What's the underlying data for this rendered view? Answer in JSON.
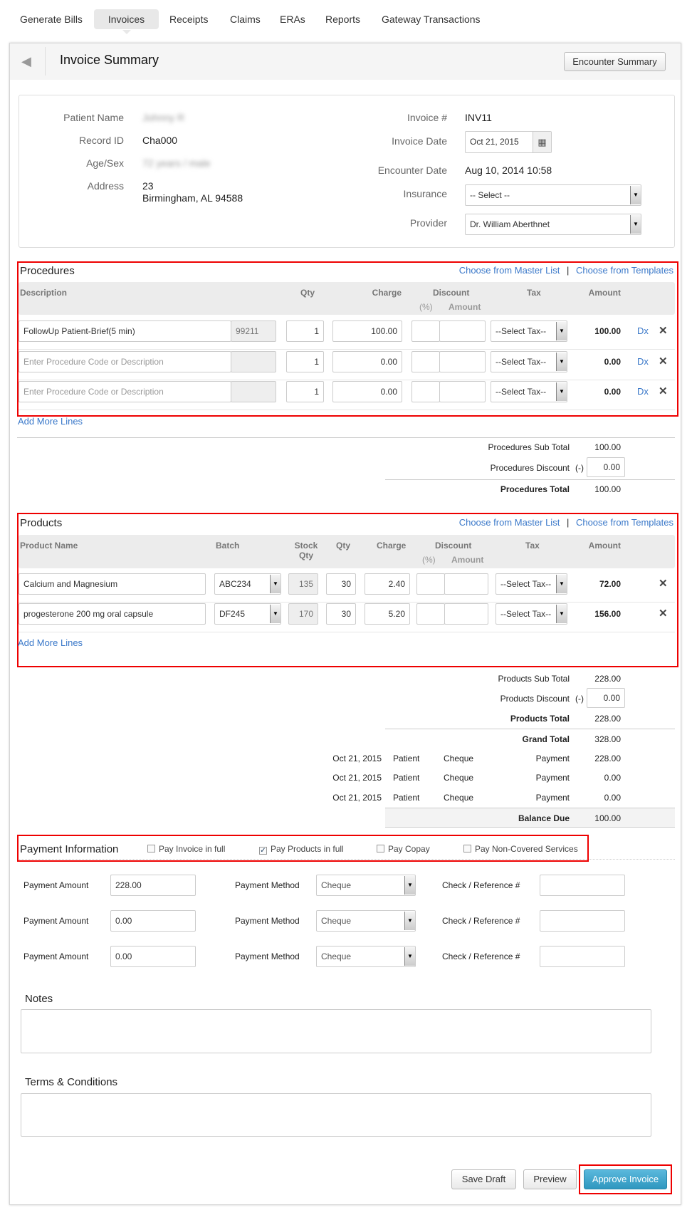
{
  "tabs": [
    "Generate Bills",
    "Invoices",
    "Receipts",
    "Claims",
    "ERAs",
    "Reports",
    "Gateway Transactions"
  ],
  "active_tab": "Invoices",
  "header": {
    "title": "Invoice Summary",
    "encounter_button": "Encounter Summary"
  },
  "patient": {
    "name_label": "Patient Name",
    "name": "Johnny R",
    "record_label": "Record ID",
    "record": "Cha000",
    "age_label": "Age/Sex",
    "age": "72 years / male",
    "address_label": "Address",
    "address1": "23",
    "address2": "Birmingham, AL 94588"
  },
  "invoice": {
    "num_label": "Invoice #",
    "num": "INV11",
    "date_label": "Invoice Date",
    "date": "Oct 21, 2015",
    "enc_label": "Encounter Date",
    "enc": "Aug 10, 2014 10:58",
    "ins_label": "Insurance",
    "ins": "-- Select --",
    "prov_label": "Provider",
    "prov": "Dr. William Aberthnet"
  },
  "links": {
    "master": "Choose from Master List",
    "sep": "|",
    "templates": "Choose from Templates",
    "add_more": "Add More Lines"
  },
  "procedures": {
    "title": "Procedures",
    "headers": {
      "desc": "Description",
      "qty": "Qty",
      "charge": "Charge",
      "discount": "Discount",
      "pct": "(%)",
      "amt": "Amount",
      "tax": "Tax",
      "amount": "Amount"
    },
    "placeholder": "Enter Procedure Code or Description",
    "rows": [
      {
        "desc": "FollowUp Patient-Brief(5 min)",
        "code": "99211",
        "qty": "1",
        "charge": "100.00",
        "tax": "--Select Tax--",
        "amount": "100.00",
        "dx": "Dx"
      },
      {
        "desc": "",
        "code": "",
        "qty": "1",
        "charge": "0.00",
        "tax": "--Select Tax--",
        "amount": "0.00",
        "dx": "Dx"
      },
      {
        "desc": "",
        "code": "",
        "qty": "1",
        "charge": "0.00",
        "tax": "--Select Tax--",
        "amount": "0.00",
        "dx": "Dx"
      }
    ],
    "sub_label": "Procedures Sub Total",
    "sub": "100.00",
    "disc_label": "Procedures Discount",
    "disc_sign": "(-)",
    "disc": "0.00",
    "total_label": "Procedures Total",
    "total": "100.00"
  },
  "products": {
    "title": "Products",
    "headers": {
      "name": "Product Name",
      "batch": "Batch",
      "stock": "Stock Qty",
      "qty": "Qty",
      "charge": "Charge",
      "discount": "Discount",
      "pct": "(%)",
      "amt": "Amount",
      "tax": "Tax",
      "amount": "Amount"
    },
    "rows": [
      {
        "name": "Calcium and Magnesium",
        "batch": "ABC234",
        "stock": "135",
        "qty": "30",
        "charge": "2.40",
        "tax": "--Select Tax--",
        "amount": "72.00"
      },
      {
        "name": "progesterone 200 mg oral capsule",
        "batch": "DF245",
        "stock": "170",
        "qty": "30",
        "charge": "5.20",
        "tax": "--Select Tax--",
        "amount": "156.00"
      }
    ],
    "sub_label": "Products Sub Total",
    "sub": "228.00",
    "disc_label": "Products Discount",
    "disc_sign": "(-)",
    "disc": "0.00",
    "total_label": "Products Total",
    "total": "228.00"
  },
  "grand_label": "Grand Total",
  "grand": "328.00",
  "payments": [
    {
      "date": "Oct 21, 2015",
      "payer": "Patient",
      "method": "Cheque",
      "type": "Payment",
      "amount": "228.00"
    },
    {
      "date": "Oct 21, 2015",
      "payer": "Patient",
      "method": "Cheque",
      "type": "Payment",
      "amount": "0.00"
    },
    {
      "date": "Oct 21, 2015",
      "payer": "Patient",
      "method": "Cheque",
      "type": "Payment",
      "amount": "0.00"
    }
  ],
  "balance_label": "Balance Due",
  "balance": "100.00",
  "payment_info": {
    "title": "Payment Information",
    "checks": [
      {
        "label": "Pay Invoice in full",
        "checked": false
      },
      {
        "label": "Pay Products in full",
        "checked": true
      },
      {
        "label": "Pay Copay",
        "checked": false
      },
      {
        "label": "Pay Non-Covered Services",
        "checked": false
      }
    ],
    "amount_label": "Payment Amount",
    "method_label": "Payment Method",
    "ref_label": "Check / Reference #",
    "rows": [
      {
        "amount": "228.00",
        "method": "Cheque",
        "ref": ""
      },
      {
        "amount": "0.00",
        "method": "Cheque",
        "ref": ""
      },
      {
        "amount": "0.00",
        "method": "Cheque",
        "ref": ""
      }
    ]
  },
  "notes_label": "Notes",
  "terms_label": "Terms & Conditions",
  "buttons": {
    "save": "Save Draft",
    "preview": "Preview",
    "approve": "Approve Invoice"
  },
  "colors": {
    "highlight": "#e00000",
    "link": "#3a78c9",
    "primary": "#3aa3c9"
  }
}
